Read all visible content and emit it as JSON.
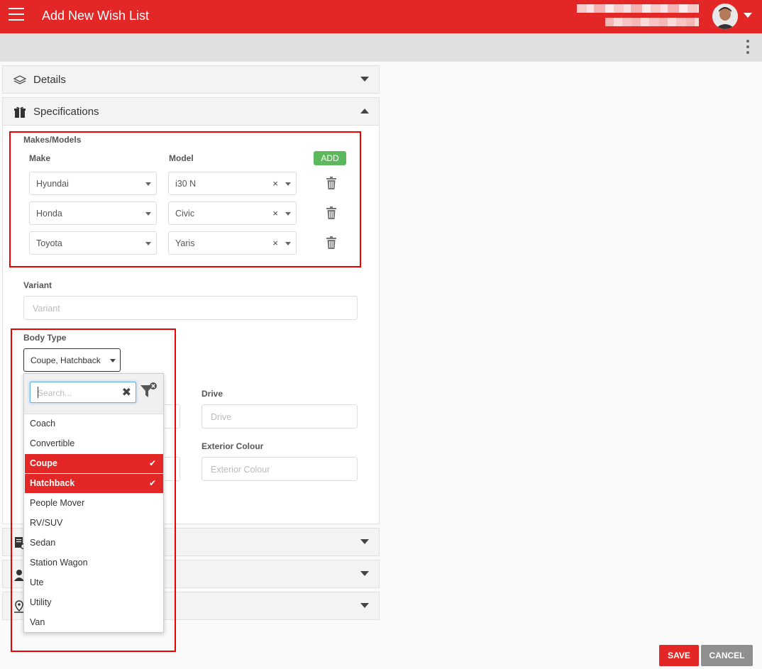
{
  "header": {
    "title": "Add New Wish List"
  },
  "panels": {
    "details": {
      "label": "Details"
    },
    "specifications": {
      "label": "Specifications"
    }
  },
  "makes_models": {
    "section_label": "Makes/Models",
    "make_label": "Make",
    "model_label": "Model",
    "add_label": "ADD",
    "rows": [
      {
        "make": "Hyundai",
        "model": "i30 N"
      },
      {
        "make": "Honda",
        "model": "Civic"
      },
      {
        "make": "Toyota",
        "model": "Yaris"
      }
    ],
    "clear_glyph": "×"
  },
  "variant": {
    "label": "Variant",
    "placeholder": "Variant"
  },
  "body_type": {
    "label": "Body Type",
    "value": "Coupe,  Hatchback",
    "search_placeholder": "Search...",
    "options": [
      {
        "label": "Coach",
        "selected": false
      },
      {
        "label": "Convertible",
        "selected": false
      },
      {
        "label": "Coupe",
        "selected": true
      },
      {
        "label": "Hatchback",
        "selected": true
      },
      {
        "label": "People Mover",
        "selected": false
      },
      {
        "label": "RV/SUV",
        "selected": false
      },
      {
        "label": "Sedan",
        "selected": false
      },
      {
        "label": "Station Wagon",
        "selected": false
      },
      {
        "label": "Ute",
        "selected": false
      },
      {
        "label": "Utility",
        "selected": false
      },
      {
        "label": "Van",
        "selected": false
      }
    ]
  },
  "drive": {
    "label": "Drive",
    "placeholder": "Drive"
  },
  "exterior_colour": {
    "label": "Exterior Colour",
    "placeholder": "Exterior Colour"
  },
  "footer": {
    "save_label": "SAVE",
    "cancel_label": "CANCEL"
  },
  "colors": {
    "brand_red": "#e32626",
    "add_green": "#5cb85c",
    "cancel_gray": "#8f8f8f"
  },
  "icons": {
    "menu": "hamburger-menu-icon",
    "details": "layers-icon",
    "specifications": "gift-icon",
    "delete": "trash-icon",
    "filter": "filter-clear-icon"
  }
}
